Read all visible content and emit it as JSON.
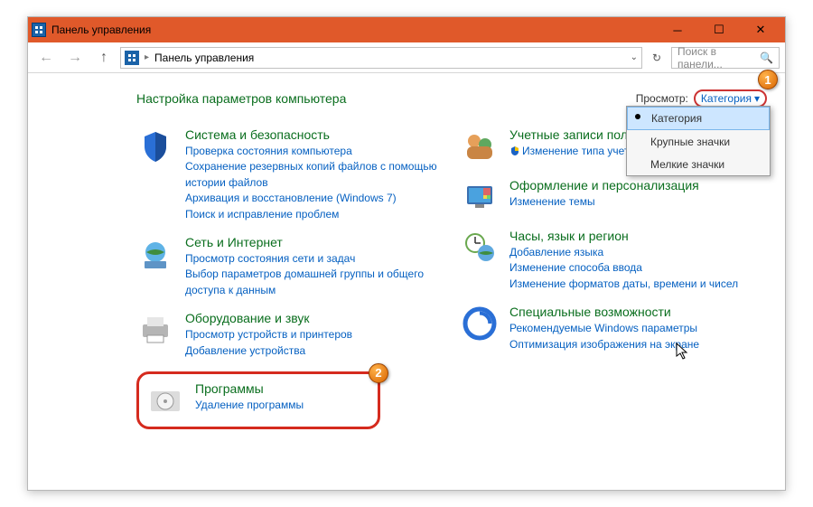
{
  "titlebar": {
    "title": "Панель управления"
  },
  "breadcrumb": {
    "label": "Панель управления"
  },
  "search": {
    "placeholder": "Поиск в панели..."
  },
  "header": {
    "heading": "Настройка параметров компьютера",
    "view_label": "Просмотр:",
    "view_value": "Категория"
  },
  "dropdown": {
    "items": [
      "Категория",
      "Крупные значки",
      "Мелкие значки"
    ],
    "selected_index": 0
  },
  "annotations": {
    "one": "1",
    "two": "2"
  },
  "left_col": [
    {
      "title": "Система и безопасность",
      "links": [
        "Проверка состояния компьютера",
        "Сохранение резервных копий файлов с помощью истории файлов",
        "Архивация и восстановление (Windows 7)",
        "Поиск и исправление проблем"
      ]
    },
    {
      "title": "Сеть и Интернет",
      "links": [
        "Просмотр состояния сети и задач",
        "Выбор параметров домашней группы и общего доступа к данным"
      ]
    },
    {
      "title": "Оборудование и звук",
      "links": [
        "Просмотр устройств и принтеров",
        "Добавление устройства"
      ]
    }
  ],
  "programs": {
    "title": "Программы",
    "link": "Удаление программы"
  },
  "right_col": [
    {
      "title": "Учетные записи пользователей",
      "links": [
        "Изменение типа учетной записи"
      ],
      "shield": true
    },
    {
      "title": "Оформление и персонализация",
      "links": [
        "Изменение темы"
      ]
    },
    {
      "title": "Часы, язык и регион",
      "links": [
        "Добавление языка",
        "Изменение способа ввода",
        "Изменение форматов даты, времени и чисел"
      ]
    },
    {
      "title": "Специальные возможности",
      "links": [
        "Рекомендуемые Windows параметры",
        "Оптимизация изображения на экране"
      ]
    }
  ]
}
